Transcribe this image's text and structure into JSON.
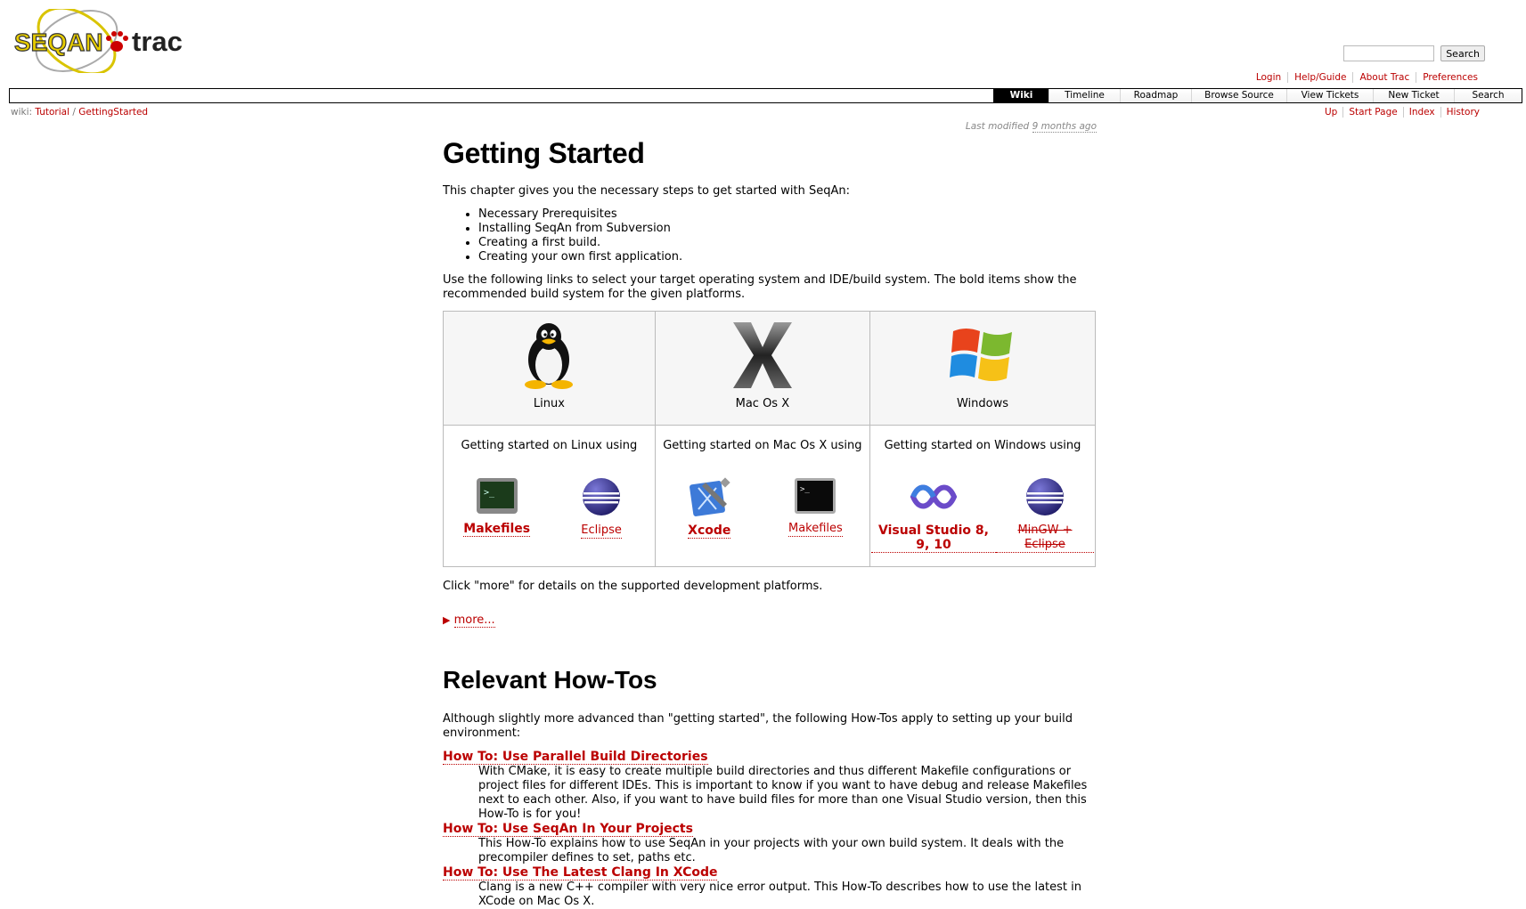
{
  "header": {
    "logo_left": "SEQAN",
    "logo_right": "trac",
    "search_button": "Search",
    "search_placeholder": ""
  },
  "metanav": [
    "Login",
    "Help/Guide",
    "About Trac",
    "Preferences"
  ],
  "mainnav": [
    {
      "label": "Wiki",
      "active": true
    },
    {
      "label": "Timeline",
      "active": false
    },
    {
      "label": "Roadmap",
      "active": false
    },
    {
      "label": "Browse Source",
      "active": false
    },
    {
      "label": "View Tickets",
      "active": false
    },
    {
      "label": "New Ticket",
      "active": false
    },
    {
      "label": "Search",
      "active": false
    }
  ],
  "breadcrumb": {
    "prefix": "wiki:",
    "parent": "Tutorial",
    "separator": "/",
    "current": "GettingStarted"
  },
  "ctxtnav": [
    "Up",
    "Start Page",
    "Index",
    "History"
  ],
  "last_modified": {
    "prefix": "Last modified",
    "time": "9 months ago"
  },
  "page": {
    "title": "Getting Started",
    "intro": "This chapter gives you the necessary steps to get started with SeqAn:",
    "steps": [
      "Necessary Prerequisites",
      "Installing SeqAn from Subversion",
      "Creating a first build.",
      "Creating your own first application."
    ],
    "links_text": "Use the following links to select your target operating system and IDE/build system. The bold items show the recommended build system for the given platforms.",
    "platforms": [
      {
        "name": "Linux",
        "icon": "linux-penguin-icon",
        "heading": "Getting started on Linux using",
        "tools": [
          {
            "label": "Makefiles",
            "icon": "terminal-icon",
            "recommended": true,
            "deprecated": false
          },
          {
            "label": "Eclipse",
            "icon": "eclipse-icon",
            "recommended": false,
            "deprecated": false
          }
        ]
      },
      {
        "name": "Mac Os X",
        "icon": "mac-os-x-icon",
        "heading": "Getting started on Mac Os X using",
        "tools": [
          {
            "label": "Xcode",
            "icon": "xcode-icon",
            "recommended": true,
            "deprecated": false
          },
          {
            "label": "Makefiles",
            "icon": "terminal-icon",
            "recommended": false,
            "deprecated": false
          }
        ]
      },
      {
        "name": "Windows",
        "icon": "windows-logo-icon",
        "heading": "Getting started on Windows using",
        "tools": [
          {
            "label": "Visual Studio 8, 9, 10",
            "icon": "visual-studio-icon",
            "recommended": true,
            "deprecated": false
          },
          {
            "label": "MinGW + Eclipse",
            "icon": "eclipse-icon",
            "recommended": false,
            "deprecated": true
          }
        ]
      }
    ],
    "more_note": "Click \"more\" for details on the supported development platforms.",
    "more_link": "more...",
    "howtos_title": "Relevant How-Tos",
    "howtos_intro": "Although slightly more advanced than \"getting started\", the following How-Tos apply to setting up your build environment:",
    "howtos": [
      {
        "title": "How To: Use Parallel Build Directories",
        "desc": "With CMake, it is easy to create multiple build directories and thus different Makefile configurations or project files for different IDEs. This is important to know if you want to have debug and release Makefiles next to each other. Also, if you want to have build files for more than one Visual Studio version, then this How-To is for you!"
      },
      {
        "title": "How To: Use SeqAn In Your Projects",
        "desc": "This How-To explains how to use SeqAn in your projects with your own build system. It deals with the precompiler defines to set, paths etc."
      },
      {
        "title": "How To: Use The Latest Clang In XCode",
        "desc": "Clang is a new C++ compiler with very nice error output. This How-To describes how to use the latest in XCode on Mac Os X."
      }
    ]
  },
  "colors": {
    "link": "#bb0000",
    "nav_active_bg": "#000000"
  }
}
